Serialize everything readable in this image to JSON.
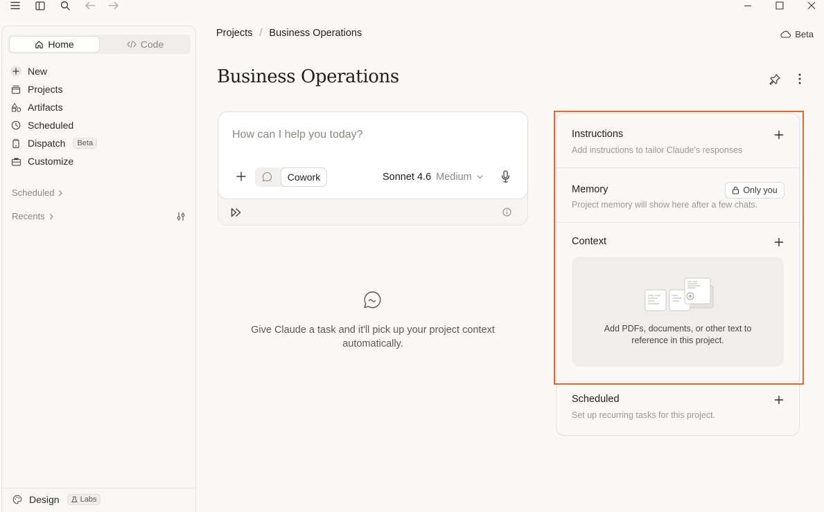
{
  "window": {
    "controls": [
      "minimize-icon",
      "maximize-icon",
      "close-icon"
    ]
  },
  "toolbar": {
    "icons": [
      "menu-icon",
      "sidebar-toggle-icon",
      "search-icon",
      "back-arrow-icon",
      "forward-arrow-icon"
    ]
  },
  "sidebar": {
    "tabs": [
      {
        "label": "Home",
        "icon": "home-icon",
        "active": true
      },
      {
        "label": "Code",
        "icon": "code-icon",
        "active": false
      }
    ],
    "items": [
      {
        "label": "New",
        "icon": "plus-icon"
      },
      {
        "label": "Projects",
        "icon": "folder-icon"
      },
      {
        "label": "Artifacts",
        "icon": "shapes-icon"
      },
      {
        "label": "Scheduled",
        "icon": "clock-icon"
      },
      {
        "label": "Dispatch",
        "icon": "phone-icon",
        "badge": "Beta"
      },
      {
        "label": "Customize",
        "icon": "briefcase-icon"
      }
    ],
    "scheduled_header": "Scheduled",
    "recents_header": "Recents",
    "footer": {
      "label": "Design",
      "badge": "Labs",
      "icon": "palette-icon"
    }
  },
  "breadcrumb": {
    "root": "Projects",
    "separator": "/",
    "current": "Business Operations"
  },
  "top_right": {
    "label": "Beta",
    "icon": "cloud-icon"
  },
  "page": {
    "title": "Business Operations"
  },
  "composer": {
    "placeholder": "How can I help you today?",
    "mode": "Cowork",
    "model": "Sonnet 4.6",
    "effort": "Medium"
  },
  "empty_state": {
    "text": "Give Claude a task and it'll pick up your project context automatically."
  },
  "panel": {
    "instructions": {
      "title": "Instructions",
      "subtitle": "Add instructions to tailor Claude's responses"
    },
    "memory": {
      "title": "Memory",
      "subtitle": "Project memory will show here after a few chats.",
      "badge": "Only you"
    },
    "context": {
      "title": "Context",
      "description": "Add PDFs, documents, or other text to reference in this project."
    },
    "scheduled": {
      "title": "Scheduled",
      "subtitle": "Set up recurring tasks for this project."
    }
  },
  "colors": {
    "accent_highlight": "#e8662a",
    "background": "#faf9f7"
  }
}
